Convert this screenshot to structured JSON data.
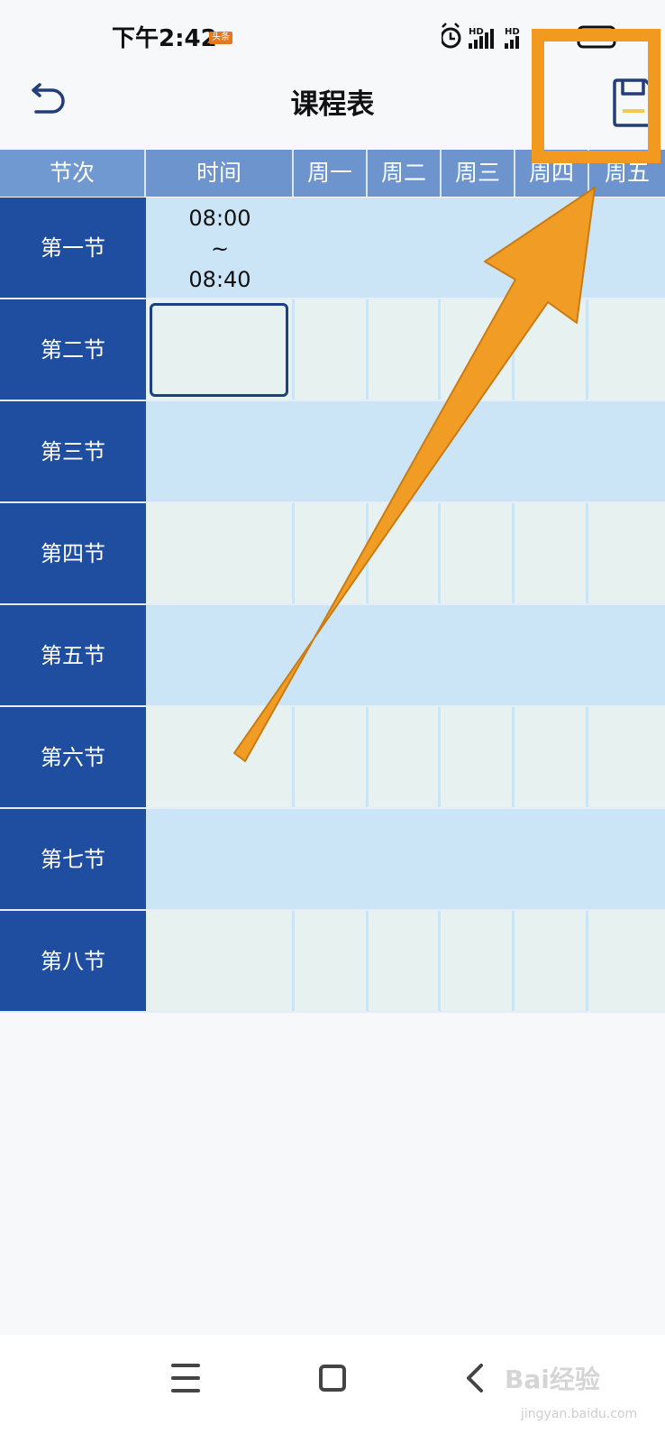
{
  "status_bar": {
    "time": "下午2:42",
    "badge": "头条",
    "signal_labels": [
      "HD",
      "HD"
    ]
  },
  "header": {
    "title": "课程表",
    "back_icon": "back-arrow-icon",
    "save_icon": "save-icon"
  },
  "table": {
    "columns": [
      "节次",
      "时间",
      "周一",
      "周二",
      "周三",
      "周四",
      "周五"
    ],
    "rows": [
      {
        "label": "第一节",
        "time_start": "08:00",
        "time_sep": "~",
        "time_end": "08:40"
      },
      {
        "label": "第二节"
      },
      {
        "label": "第三节"
      },
      {
        "label": "第四节"
      },
      {
        "label": "第五节"
      },
      {
        "label": "第六节"
      },
      {
        "label": "第七节"
      },
      {
        "label": "第八节"
      }
    ]
  },
  "colors": {
    "header_bg": "#6d94cd",
    "row_label_bg": "#1f4ea1",
    "row_light_blue": "#cbe4f6",
    "row_pale": "#e7f1ef",
    "annotation": "#f29a1f"
  },
  "nav_bar": {
    "menu_icon": "menu-icon",
    "home_icon": "home-square-icon",
    "back_icon": "back-chevron-icon"
  },
  "watermark": {
    "brand": "Bai经验",
    "url": "jingyan.baidu.com"
  }
}
